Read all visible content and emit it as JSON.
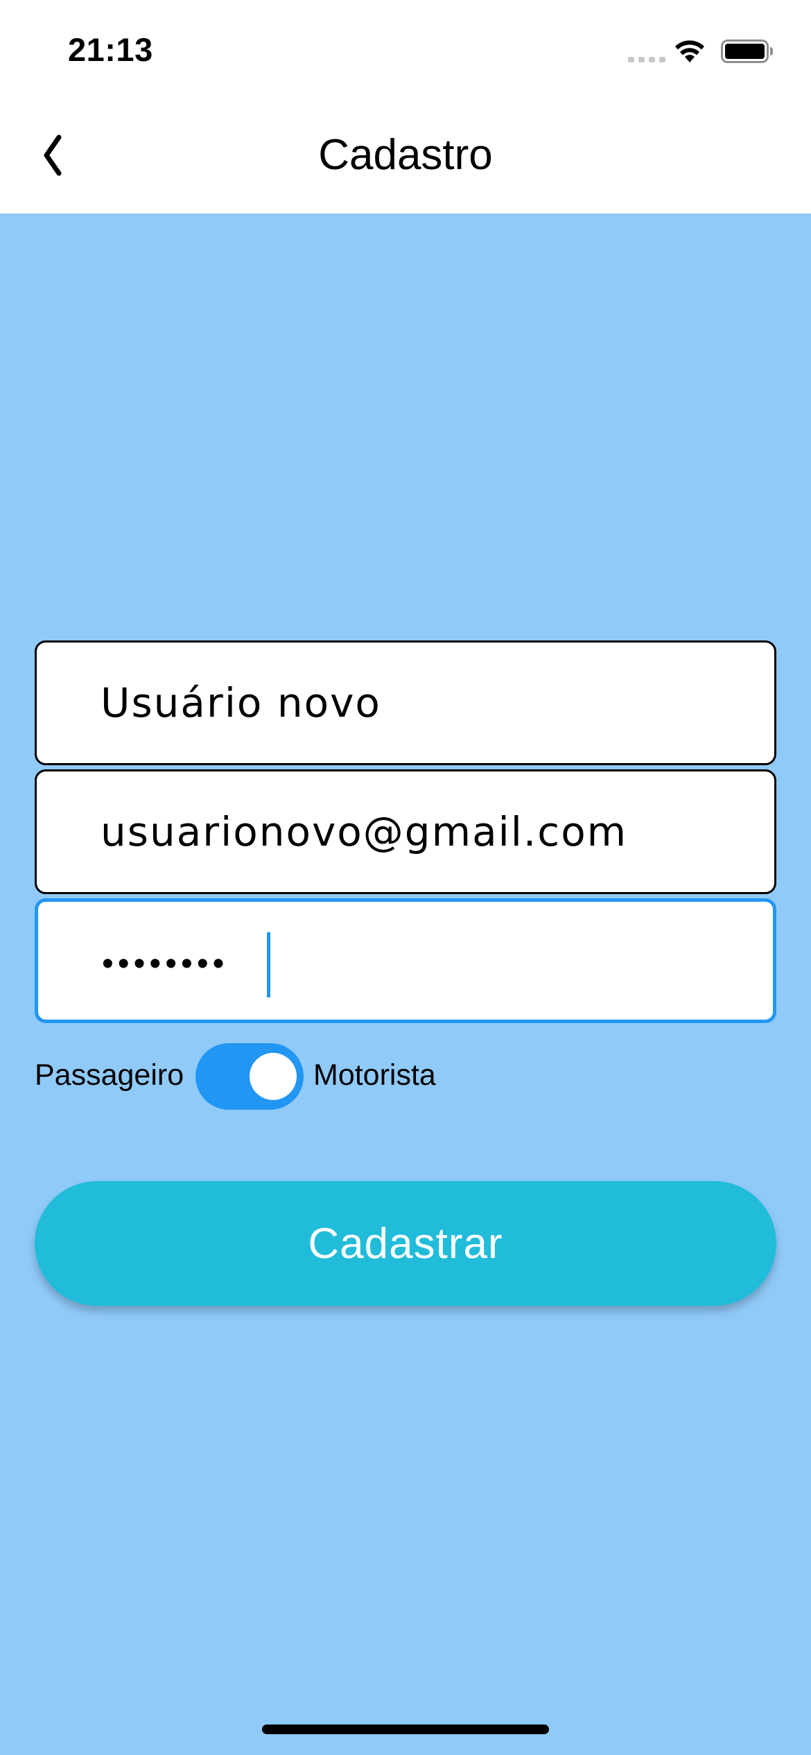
{
  "status_bar": {
    "time": "21:13"
  },
  "nav": {
    "title": "Cadastro",
    "back_icon": "chevron-left-icon"
  },
  "form": {
    "name": {
      "value": "Usuário novo"
    },
    "email": {
      "value": "usuarionovo@gmail.com"
    },
    "password": {
      "masked": "••••••••"
    },
    "user_type": {
      "left_label": "Passageiro",
      "right_label": "Motorista",
      "on": true
    },
    "submit_label": "Cadastrar"
  },
  "colors": {
    "background": "#90CAF9",
    "accent": "#2196F3",
    "button": "#21BCDA"
  }
}
